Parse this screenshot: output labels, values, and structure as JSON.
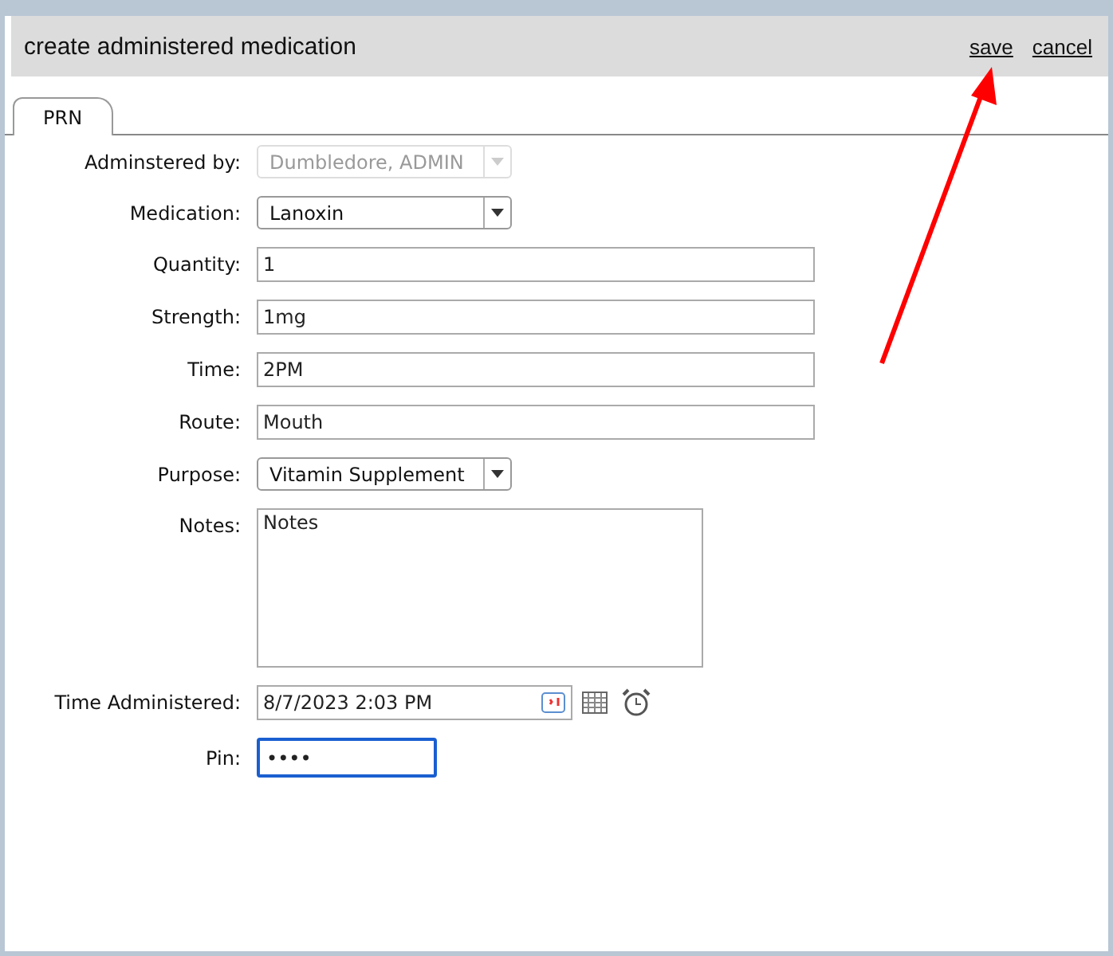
{
  "window": {
    "title": "create administered medication",
    "actions": [
      "save",
      "cancel"
    ]
  },
  "tabs": [
    {
      "label": "PRN",
      "selected": true
    }
  ],
  "fields": [
    {
      "kind": "select",
      "label": "Adminstered by:",
      "value": "Dumbledore, ADMIN",
      "disabled": true
    },
    {
      "kind": "select",
      "label": "Medication:",
      "value": "Lanoxin",
      "disabled": false
    },
    {
      "kind": "text",
      "label": "Quantity:",
      "value": "1"
    },
    {
      "kind": "text",
      "label": "Strength:",
      "value": "1mg"
    },
    {
      "kind": "text",
      "label": "Time:",
      "value": "2PM"
    },
    {
      "kind": "text",
      "label": "Route:",
      "value": "Mouth"
    },
    {
      "kind": "select",
      "label": "Purpose:",
      "value": "Vitamin Supplement",
      "disabled": false
    },
    {
      "kind": "textarea",
      "label": "Notes:",
      "value": "Notes"
    },
    {
      "kind": "datetime",
      "label": "Time Administered:",
      "value": "8/7/2023 2:03 PM"
    },
    {
      "kind": "pin",
      "label": "Pin:",
      "value": "••••",
      "focused": true
    }
  ]
}
